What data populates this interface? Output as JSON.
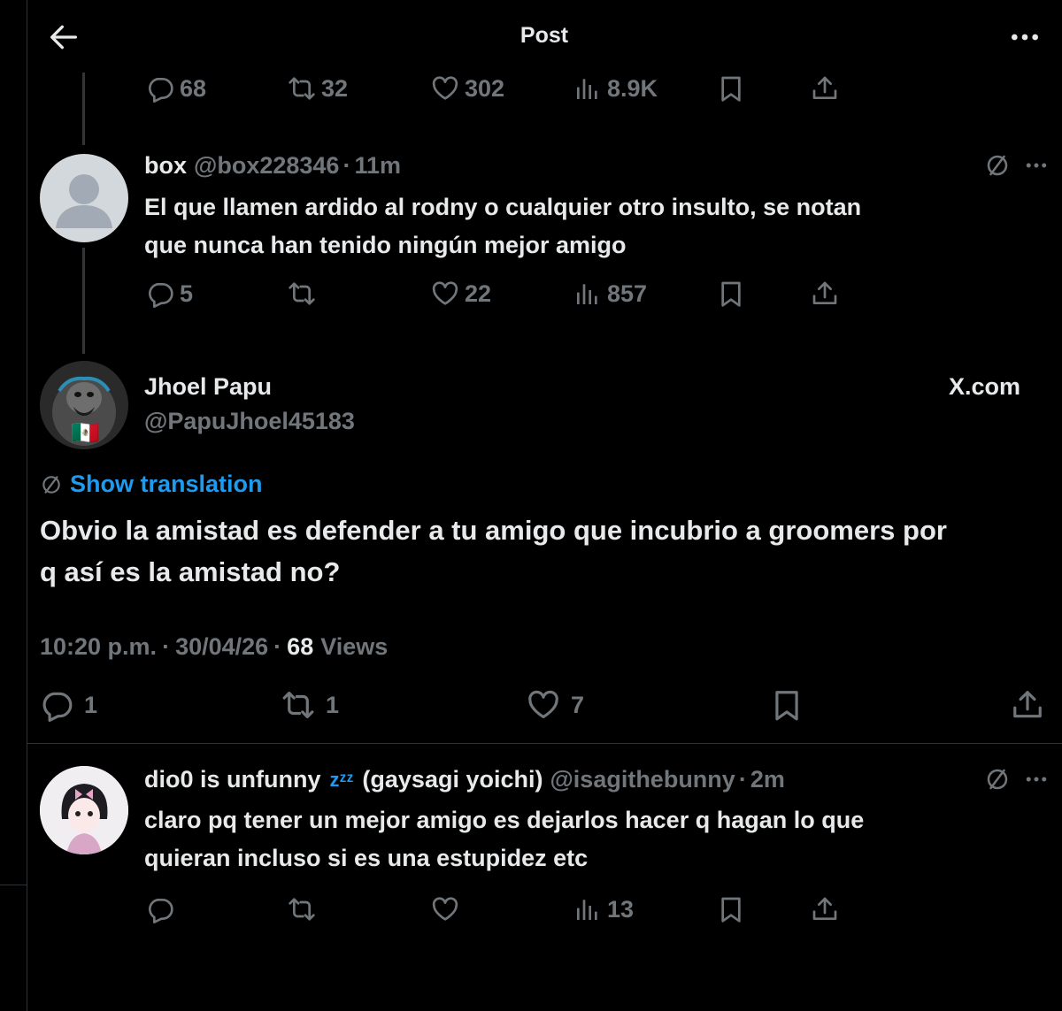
{
  "header": {
    "title": "Post"
  },
  "parent_actions": {
    "replies": "68",
    "reposts": "32",
    "likes": "302",
    "views": "8.9K"
  },
  "reply1": {
    "display_name": "box",
    "handle": "@box228346",
    "time": "11m",
    "text_line1": "El que llamen ardido al rodny o cualquier otro insulto, se notan",
    "text_line2": "que nunca han tenido ningún mejor amigo",
    "replies": "5",
    "likes": "22",
    "views": "857"
  },
  "main_post": {
    "display_name": "Jhoel Papu",
    "handle": "@PapuJhoel45183",
    "source": "X.com",
    "translate_label": "Show translation",
    "text_line1": "Obvio la amistad es defender a tu amigo que incubrio a groomers por",
    "text_line2": "q así es la amistad no?",
    "time": "10:20 p.m.",
    "date": "30/04/26",
    "views_count": "68",
    "views_label": "Views",
    "replies": "1",
    "reposts": "1",
    "likes": "7",
    "avatar_flag": "🇲🇽"
  },
  "reply2": {
    "display_name": "dio0 is unfunny",
    "name_emoji": "zᶻᶻ",
    "name_suffix": "(gaysagi yoichi)",
    "handle": "@isagithebunny",
    "time": "2m",
    "text_line1": "claro pq tener un mejor amigo es dejarlos hacer q hagan lo que",
    "text_line2": "quieran incluso si es una estupidez etc",
    "views": "13"
  },
  "separator": "·",
  "colors": {
    "accent": "#1d9bf0",
    "muted": "#71767b",
    "text": "#e7e9ea",
    "bg": "#000000",
    "border": "#2f3336"
  },
  "icons": [
    "back-arrow-icon",
    "more-icon",
    "reply-icon",
    "repost-icon",
    "like-icon",
    "views-icon",
    "bookmark-icon",
    "share-icon",
    "translate-icon"
  ]
}
